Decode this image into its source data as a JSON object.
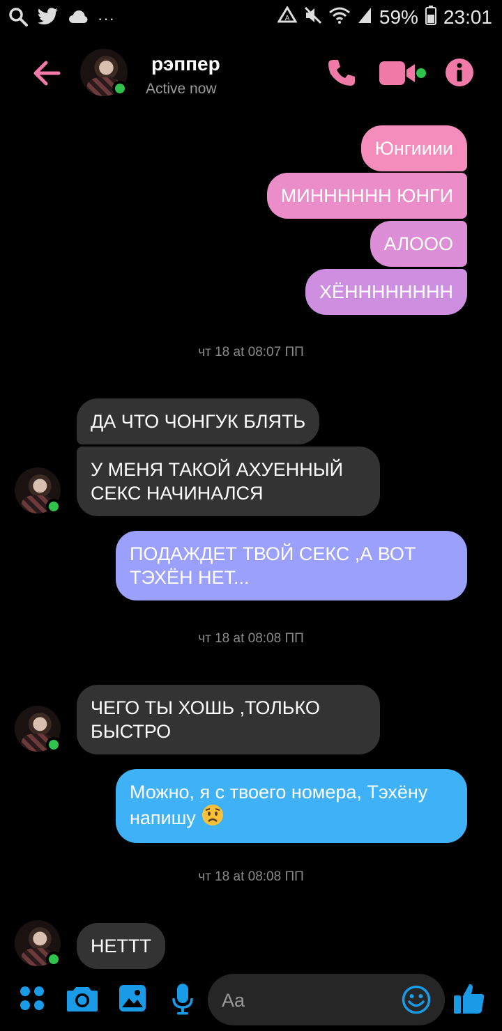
{
  "status_bar": {
    "battery": "59%",
    "time": "23:01",
    "more": "···"
  },
  "header": {
    "contact_name": "рэппер",
    "contact_status": "Active now"
  },
  "messages": [
    {
      "dir": "out",
      "text": "Юнгииии"
    },
    {
      "dir": "out",
      "text": "МИНННННН ЮНГИ"
    },
    {
      "dir": "out",
      "text": "АЛООО"
    },
    {
      "dir": "out",
      "text": "ХЁНННННННН"
    },
    {
      "dir": "timestamp",
      "text": "чт 18 at 08:07 ПП"
    },
    {
      "dir": "in",
      "text": "ДА ЧТО ЧОНГУК БЛЯТЬ"
    },
    {
      "dir": "in",
      "line1": "У МЕНЯ ТАКОЙ АХУЕННЫЙ",
      "line2": "СЕКС НАЧИНАЛСЯ"
    },
    {
      "dir": "out",
      "line1": "ПОДАЖДЕТ ТВОЙ СЕКС ,А ВОТ",
      "line2": "ТЭХЁН НЕТ..."
    },
    {
      "dir": "timestamp",
      "text": "чт 18 at 08:08 ПП"
    },
    {
      "dir": "in",
      "line1": "ЧЕГО ТЫ ХОШЬ ,ТОЛЬКО",
      "line2": "БЫСТРО"
    },
    {
      "dir": "out",
      "line1": "Можно, я с твоего номера, Тэхёну",
      "line2": "напишу"
    },
    {
      "dir": "timestamp",
      "text": "чт 18 at 08:08 ПП"
    },
    {
      "dir": "in",
      "text": "НЕТТТ"
    }
  ],
  "composer": {
    "placeholder": "Aa"
  },
  "colors": {
    "accent_pink": "#f07aa8",
    "bubble_incoming": "#333334",
    "online_green": "#31c24d",
    "composer_blue": "#1a9be8"
  }
}
